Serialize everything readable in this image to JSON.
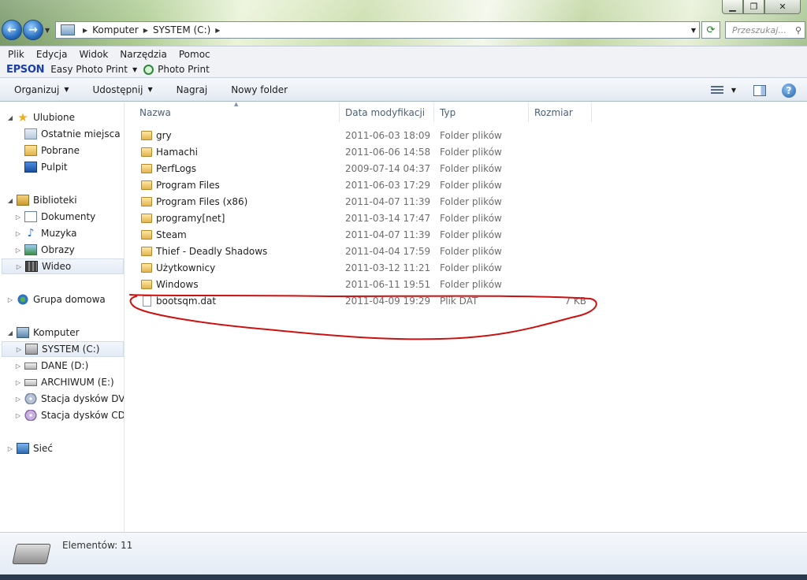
{
  "window": {
    "buttons": {
      "minimize": "▁",
      "maximize": "❐",
      "close": "✕"
    }
  },
  "address": {
    "crumbs": [
      "Komputer",
      "SYSTEM (C:)"
    ],
    "search_placeholder": "Przeszukaj..."
  },
  "menu": [
    "Plik",
    "Edycja",
    "Widok",
    "Narzędzia",
    "Pomoc"
  ],
  "epson": {
    "logo": "EPSON",
    "easy": "Easy Photo Print",
    "photo": "Photo Print"
  },
  "toolbar": {
    "organize": "Organizuj",
    "share": "Udostępnij",
    "burn": "Nagraj",
    "new_folder": "Nowy folder"
  },
  "nav": {
    "favorites": "Ulubione",
    "recent": "Ostatnie miejsca",
    "downloads": "Pobrane",
    "desktop": "Pulpit",
    "libraries": "Biblioteki",
    "documents": "Dokumenty",
    "music": "Muzyka",
    "pictures": "Obrazy",
    "video": "Wideo",
    "homegroup": "Grupa domowa",
    "computer": "Komputer",
    "drive_c": "SYSTEM (C:)",
    "drive_d": "DANE (D:)",
    "drive_e": "ARCHIWUM (E:)",
    "dvd": "Stacja dysków DVD R",
    "cd": "Stacja dysków CD (G",
    "network": "Sieć"
  },
  "columns": {
    "name": "Nazwa",
    "date": "Data modyfikacji",
    "type": "Typ",
    "size": "Rozmiar"
  },
  "files": [
    {
      "name": "gry",
      "date": "2011-06-03 18:09",
      "type": "Folder plików",
      "size": "",
      "kind": "folder"
    },
    {
      "name": "Hamachi",
      "date": "2011-06-06 14:58",
      "type": "Folder plików",
      "size": "",
      "kind": "folder"
    },
    {
      "name": "PerfLogs",
      "date": "2009-07-14 04:37",
      "type": "Folder plików",
      "size": "",
      "kind": "folder"
    },
    {
      "name": "Program Files",
      "date": "2011-06-03 17:29",
      "type": "Folder plików",
      "size": "",
      "kind": "folder"
    },
    {
      "name": "Program Files (x86)",
      "date": "2011-04-07 11:39",
      "type": "Folder plików",
      "size": "",
      "kind": "folder"
    },
    {
      "name": "programy[net]",
      "date": "2011-03-14 17:47",
      "type": "Folder plików",
      "size": "",
      "kind": "folder"
    },
    {
      "name": "Steam",
      "date": "2011-04-07 11:39",
      "type": "Folder plików",
      "size": "",
      "kind": "folder"
    },
    {
      "name": "Thief - Deadly Shadows",
      "date": "2011-04-04 17:59",
      "type": "Folder plików",
      "size": "",
      "kind": "folder"
    },
    {
      "name": "Użytkownicy",
      "date": "2011-03-12 11:21",
      "type": "Folder plików",
      "size": "",
      "kind": "folder"
    },
    {
      "name": "Windows",
      "date": "2011-06-11 19:51",
      "type": "Folder plików",
      "size": "",
      "kind": "folder"
    },
    {
      "name": "bootsqm.dat",
      "date": "2011-04-09 19:29",
      "type": "Plik DAT",
      "size": "7 KB",
      "kind": "file"
    }
  ],
  "status": {
    "count": "Elementów: 11"
  },
  "colors": {
    "annotation": "#cc1111",
    "selection": "#e3ebf5",
    "epson_blue": "#1a3fa8"
  }
}
